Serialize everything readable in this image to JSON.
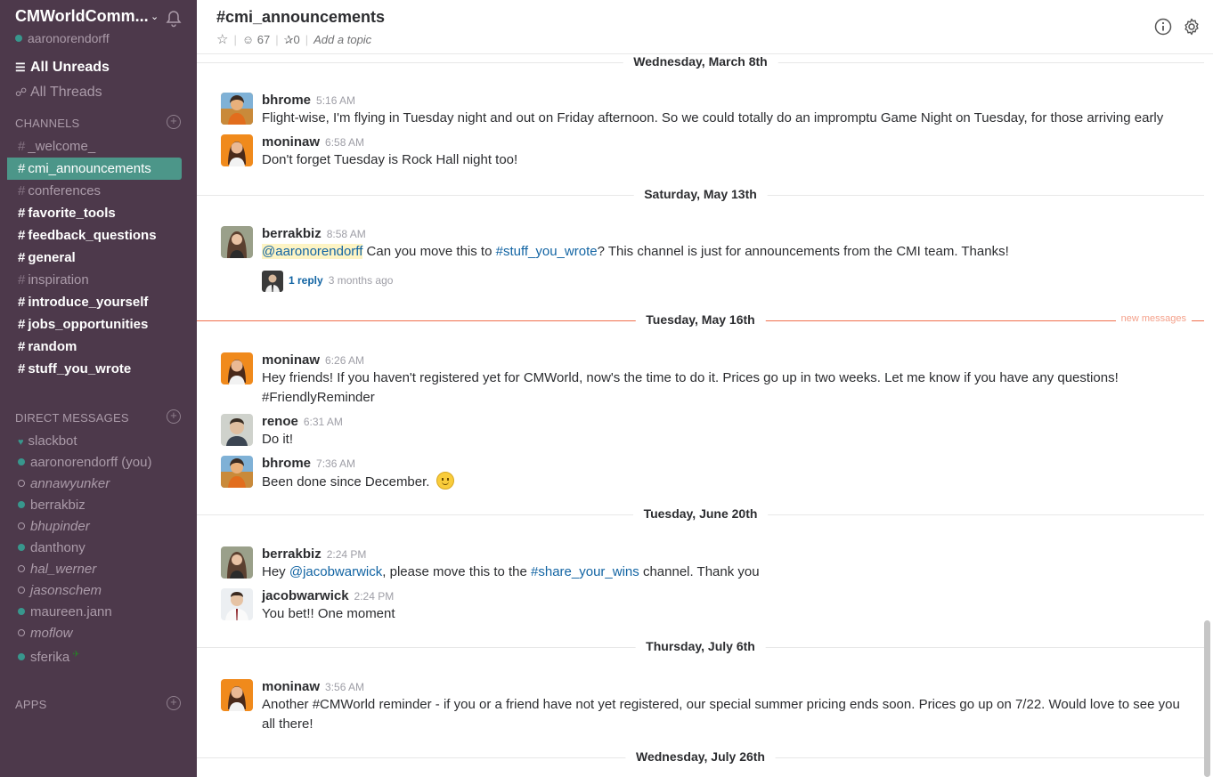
{
  "colors": {
    "sidebar_bg": "#4d394b",
    "active_channel": "#4c9689",
    "presence": "#38978d",
    "link": "#1264a3",
    "new_messages": "#f06f4d"
  },
  "sidebar": {
    "team_name": "CMWorldComm...",
    "username": "aaronorendorff",
    "all_unreads": "All Unreads",
    "all_threads": "All Threads",
    "channels_heading": "CHANNELS",
    "channels": [
      {
        "name": "_welcome_",
        "state": "read"
      },
      {
        "name": "cmi_announcements",
        "state": "active"
      },
      {
        "name": "conferences",
        "state": "read"
      },
      {
        "name": "favorite_tools",
        "state": "unread"
      },
      {
        "name": "feedback_questions",
        "state": "unread"
      },
      {
        "name": "general",
        "state": "unread"
      },
      {
        "name": "inspiration",
        "state": "read"
      },
      {
        "name": "introduce_yourself",
        "state": "unread"
      },
      {
        "name": "jobs_opportunities",
        "state": "unread"
      },
      {
        "name": "random",
        "state": "unread"
      },
      {
        "name": "stuff_you_wrote",
        "state": "unread"
      }
    ],
    "dm_heading": "DIRECT MESSAGES",
    "dms": [
      {
        "name": "slackbot",
        "status": "bot"
      },
      {
        "name": "aaronorendorff (you)",
        "status": "online"
      },
      {
        "name": "annawyunker",
        "status": "away"
      },
      {
        "name": "berrakbiz",
        "status": "online"
      },
      {
        "name": "bhupinder",
        "status": "away"
      },
      {
        "name": "danthony",
        "status": "online"
      },
      {
        "name": "hal_werner",
        "status": "away"
      },
      {
        "name": "jasonschem",
        "status": "away"
      },
      {
        "name": "maureen.jann",
        "status": "online"
      },
      {
        "name": "moflow",
        "status": "away"
      },
      {
        "name": "sferika",
        "status": "online"
      }
    ],
    "apps_heading": "APPS"
  },
  "header": {
    "channel": "#cmi_announcements",
    "members": "67",
    "pins": "0",
    "topic": "Add a topic"
  },
  "days": {
    "d1": "Wednesday, March 8th",
    "d2": "Saturday, May 13th",
    "d3": "Tuesday, May 16th",
    "d4": "Tuesday, June 20th",
    "d5": "Thursday, July 6th",
    "d6": "Wednesday, July 26th",
    "new_messages": "new messages"
  },
  "messages": {
    "m1": {
      "author": "bhrome",
      "time": "5:16 AM",
      "text": "Flight-wise, I'm flying in Tuesday night and out on Friday afternoon. So we could totally do an impromptu Game Night on Tuesday, for those arriving early"
    },
    "m2": {
      "author": "moninaw",
      "time": "6:58 AM",
      "text": "Don't forget Tuesday is Rock Hall night too!"
    },
    "m3": {
      "author": "berrakbiz",
      "time": "8:58 AM",
      "mention": "@aaronorendorff",
      "text_a": " Can you move this to ",
      "channel_link": "#stuff_you_wrote",
      "text_b": "? This channel is just for announcements from the CMI team. Thanks!",
      "reply_count": "1 reply",
      "reply_ago": "3 months ago"
    },
    "m4": {
      "author": "moninaw",
      "time": "6:26 AM",
      "text": "Hey friends! If you haven't registered yet for CMWorld, now's the time to do it. Prices go up in two weeks. Let me know if you have any questions! #FriendlyReminder"
    },
    "m5": {
      "author": "renoe",
      "time": "6:31 AM",
      "text": "Do it!"
    },
    "m6": {
      "author": "bhrome",
      "time": "7:36 AM",
      "text": "Been done since December.",
      "emoji": "slightly-smiling-face"
    },
    "m7": {
      "author": "berrakbiz",
      "time": "2:24 PM",
      "text_a": "Hey ",
      "mention": "@jacobwarwick",
      "text_b": ", please move this to the ",
      "channel_link": "#share_your_wins",
      "text_c": " channel. Thank you"
    },
    "m8": {
      "author": "jacobwarwick",
      "time": "2:24 PM",
      "text": "You bet!! One moment"
    },
    "m9": {
      "author": "moninaw",
      "time": "3:56 AM",
      "text": "Another #CMWorld reminder - if you or a friend have not yet registered, our special summer pricing ends soon. Prices go up on 7/22. Would love to see you all there!"
    }
  }
}
